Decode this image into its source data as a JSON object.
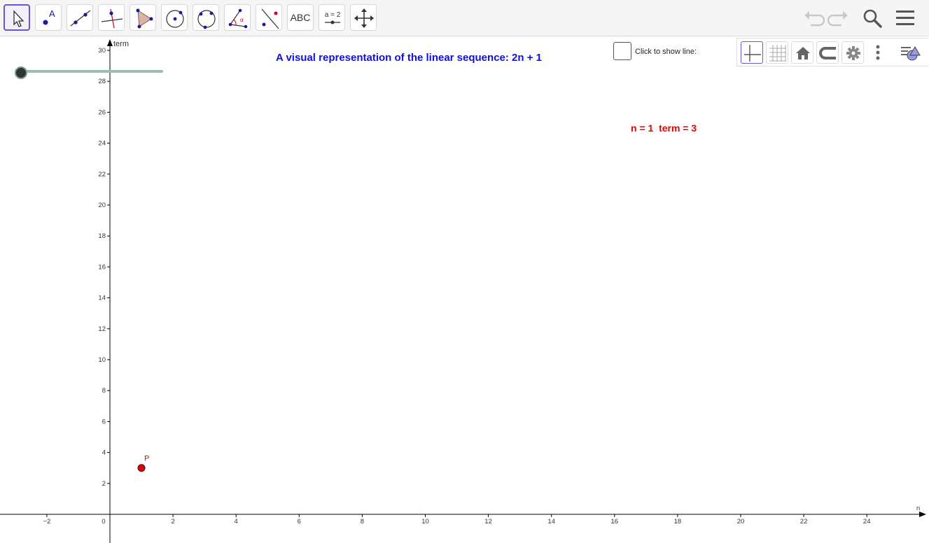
{
  "toolbar": {
    "tools": [
      {
        "name": "move-tool",
        "icon": "cursor-arrow-icon"
      },
      {
        "name": "point-tool",
        "icon": "point-icon",
        "label": "A"
      },
      {
        "name": "line-tool",
        "icon": "line-through-points-icon"
      },
      {
        "name": "perpendicular-line-tool",
        "icon": "perpendicular-line-icon"
      },
      {
        "name": "polygon-tool",
        "icon": "polygon-icon"
      },
      {
        "name": "circle-center-point-tool",
        "icon": "circle-center-icon"
      },
      {
        "name": "circle-three-points-tool",
        "icon": "circle-three-points-icon"
      },
      {
        "name": "angle-tool",
        "icon": "angle-icon",
        "label": "α"
      },
      {
        "name": "reflect-tool",
        "icon": "reflect-about-line-icon"
      },
      {
        "name": "text-tool",
        "icon": "text-icon",
        "label": "ABC"
      },
      {
        "name": "slider-tool",
        "icon": "slider-icon",
        "label": "a = 2"
      },
      {
        "name": "move-graphics-view-tool",
        "icon": "move-arrows-icon"
      }
    ],
    "right_icons": [
      "undo-icon",
      "redo-icon",
      "search-icon",
      "menu-icon"
    ]
  },
  "stylebar": {
    "buttons": [
      "axes-toggle-icon",
      "grid-toggle-icon",
      "home-icon",
      "point-capturing-icon",
      "settings-icon",
      "more-vertical-icon"
    ],
    "view_toggle": "graphics-view-toggle-icon"
  },
  "graph": {
    "title": "A visual representation of the linear sequence: 2n + 1",
    "checkbox_label": "Click to show line:",
    "checkbox_checked": false,
    "readout": "n = 1  term = 3",
    "x_axis_label": "n",
    "y_axis_label": "term",
    "x_ticks": [
      "−2",
      "0",
      "2",
      "4",
      "6",
      "8",
      "10",
      "12",
      "14",
      "16",
      "18",
      "20",
      "22",
      "24"
    ],
    "y_ticks": [
      "2",
      "4",
      "6",
      "8",
      "10",
      "12",
      "14",
      "16",
      "18",
      "20",
      "22",
      "24",
      "26",
      "28",
      "30"
    ],
    "point": {
      "label": "P",
      "n": 1,
      "term": 3,
      "color": "#e60000"
    },
    "slider": {
      "n_value": 1,
      "min": 1,
      "max": 14
    }
  },
  "colors": {
    "title": "#1010d8",
    "readout": "#e60000",
    "selected_tool": "#6557d2",
    "slider_track": "#9bbfad"
  }
}
